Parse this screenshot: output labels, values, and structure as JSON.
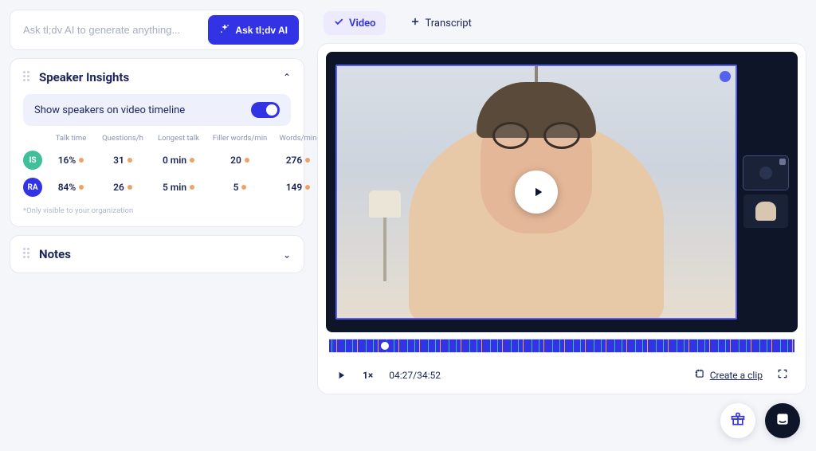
{
  "ask": {
    "placeholder": "Ask tl;dv AI to generate anything...",
    "button": "Ask tl;dv AI"
  },
  "insights": {
    "title": "Speaker Insights",
    "toggle_label": "Show speakers on video timeline",
    "toggle_on": true,
    "columns": [
      "Talk time",
      "Questions/h",
      "Longest talk",
      "Filler words/min",
      "Words/min"
    ],
    "rows": [
      {
        "initials": "IS",
        "color": "#3fbf9a",
        "values": [
          "16%",
          "31",
          "0 min",
          "20",
          "276"
        ]
      },
      {
        "initials": "RA",
        "color": "#3333e6",
        "values": [
          "84%",
          "26",
          "5 min",
          "5",
          "149"
        ]
      }
    ],
    "footnote": "*Only visible to your organization"
  },
  "notes": {
    "title": "Notes"
  },
  "tabs": {
    "video": "Video",
    "transcript": "Transcript",
    "active": "video"
  },
  "player": {
    "timecode": "04:27/34:52",
    "speed": "1×",
    "clip_label": "Create a clip"
  }
}
